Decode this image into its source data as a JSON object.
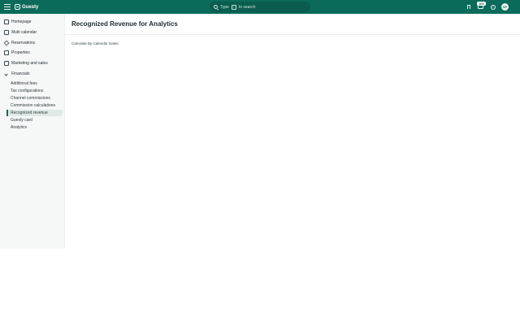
{
  "app": {
    "brand": "Guesty",
    "search_placeholder_pre": "Type",
    "search_key": "/",
    "search_placeholder_post": "to search",
    "notification_count": "100",
    "help_glyph": "?",
    "avatar_initials": "VP"
  },
  "sidebar": {
    "items": [
      {
        "label": "Homepage",
        "icon": "home-icon"
      },
      {
        "label": "Multi calendar",
        "icon": "calendar-icon"
      },
      {
        "label": "Reservations",
        "icon": "reservations-icon"
      },
      {
        "label": "Properties",
        "icon": "building-icon"
      },
      {
        "label": "Marketing and sales",
        "icon": "marketing-icon"
      },
      {
        "label": "Financials",
        "icon": "financials-icon"
      }
    ],
    "financials_sub": [
      {
        "label": "Additional fees"
      },
      {
        "label": "Tax configurations"
      },
      {
        "label": "Channel commissions"
      },
      {
        "label": "Commission calculations"
      },
      {
        "label": "Recognized revenue",
        "active": true
      },
      {
        "label": "Guesty card"
      },
      {
        "label": "Analytics"
      }
    ]
  },
  "main": {
    "title": "Recognized Revenue for Analytics",
    "subtitle": "Calculate By Calendar Dates"
  }
}
